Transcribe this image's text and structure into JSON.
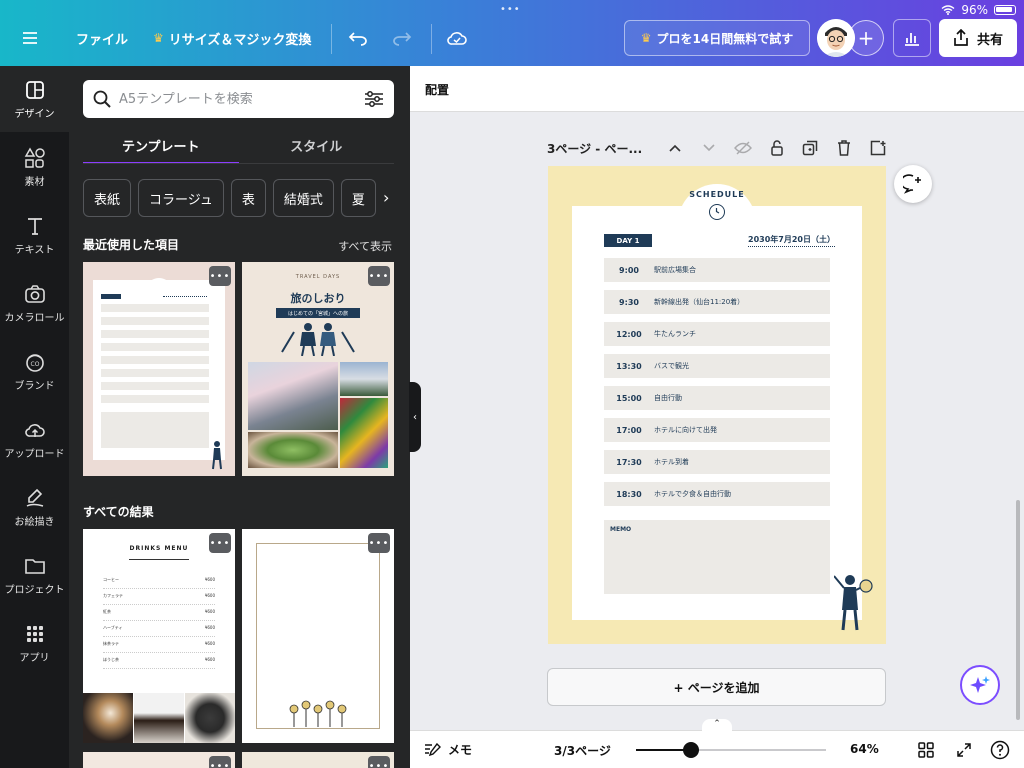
{
  "status": {
    "battery": "96%"
  },
  "toolbar": {
    "file": "ファイル",
    "resize": "リサイズ＆マジック変換",
    "pro_trial": "プロを14日間無料で試す",
    "share": "共有"
  },
  "rail": [
    {
      "label": "デザイン",
      "icon": "design-icon"
    },
    {
      "label": "素材",
      "icon": "elements-icon"
    },
    {
      "label": "テキスト",
      "icon": "text-icon"
    },
    {
      "label": "カメラロール",
      "icon": "camera-icon"
    },
    {
      "label": "ブランド",
      "icon": "brand-icon"
    },
    {
      "label": "アップロード",
      "icon": "upload-icon"
    },
    {
      "label": "お絵描き",
      "icon": "draw-icon"
    },
    {
      "label": "プロジェクト",
      "icon": "folder-icon"
    },
    {
      "label": "アプリ",
      "icon": "apps-icon"
    }
  ],
  "panel": {
    "search_placeholder": "A5テンプレートを検索",
    "tabs": [
      "テンプレート",
      "スタイル"
    ],
    "chips": [
      "表紙",
      "コラージュ",
      "表",
      "結婚式",
      "夏"
    ],
    "recent_title": "最近使用した項目",
    "show_all": "すべて表示",
    "all_results_title": "すべての結果",
    "travel_thumb": {
      "title": "旅のしおり",
      "subtitle": "はじめての「宮城」への旅",
      "tag": "TRAVEL DAYS"
    },
    "drinks_thumb": {
      "title": "DRINKS MENU",
      "items": [
        {
          "name": "コーヒー",
          "price": "¥600"
        },
        {
          "name": "カフェラテ",
          "price": "¥600"
        },
        {
          "name": "紅茶",
          "price": "¥600"
        },
        {
          "name": "ハーブティ",
          "price": "¥600"
        },
        {
          "name": "抹茶ラテ",
          "price": "¥600"
        },
        {
          "name": "ほうじ茶",
          "price": "¥600"
        }
      ]
    }
  },
  "canvas": {
    "subbar_label": "配置",
    "page_label": "3ページ - ペー...",
    "schedule_heading": "SCHEDULE",
    "day_tag": "DAY 1",
    "date": "2030年7月20日（土）",
    "rows": [
      {
        "time": "9:00",
        "text": "駅前広場集合"
      },
      {
        "time": "9:30",
        "text": "新幹線出発（仙台11:20着）"
      },
      {
        "time": "12:00",
        "text": "牛たんランチ"
      },
      {
        "time": "13:30",
        "text": "バスで観光"
      },
      {
        "time": "15:00",
        "text": "自由行動"
      },
      {
        "time": "17:00",
        "text": "ホテルに向けて出発"
      },
      {
        "time": "17:30",
        "text": "ホテル到着"
      },
      {
        "time": "18:30",
        "text": "ホテルで夕食＆自由行動"
      }
    ],
    "memo_label": "MEMO",
    "add_page": "+ ページを追加"
  },
  "bottombar": {
    "memo": "メモ",
    "pages": "3/3ページ",
    "zoom_value": 64,
    "zoom": "64%"
  },
  "colors": {
    "accent": "#8b3dff",
    "navy": "#1f3b57",
    "page_bg": "#f6e9b4",
    "row_bg": "#eceae6"
  }
}
